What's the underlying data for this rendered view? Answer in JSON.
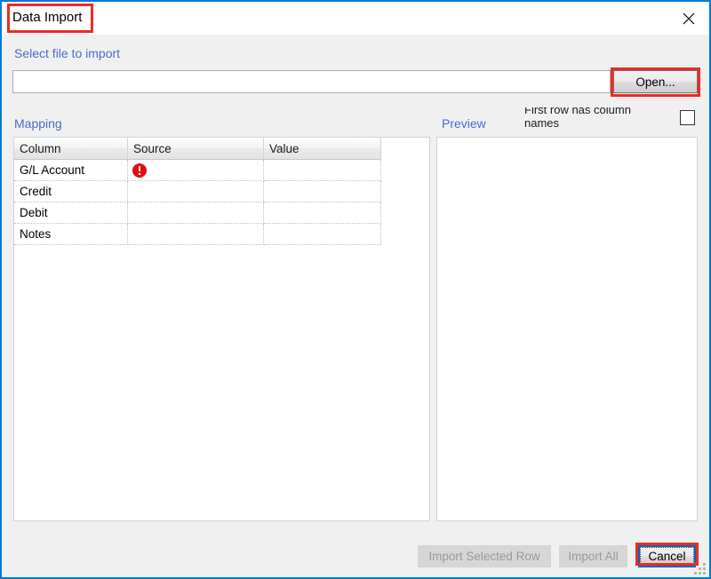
{
  "window": {
    "title": "Data Import",
    "close_icon": "close-icon",
    "accent_color": "#0078d7",
    "annotation_color": "#ee2b22"
  },
  "form": {
    "select_file_label": "Select file to import",
    "file_path_value": "",
    "file_path_placeholder": "",
    "open_button_label": "Open...",
    "first_row_label": "First row has column names",
    "first_row_checked": false
  },
  "sections": {
    "mapping_label": "Mapping",
    "preview_label": "Preview"
  },
  "grid": {
    "headers": [
      "Column",
      "Source",
      "Value"
    ],
    "rows": [
      {
        "column": "G/L Account",
        "source": "",
        "value": "",
        "selected": true,
        "status_icon": "error-icon"
      },
      {
        "column": "Credit",
        "source": "",
        "value": "",
        "selected": false,
        "status_icon": ""
      },
      {
        "column": "Debit",
        "source": "",
        "value": "",
        "selected": false,
        "status_icon": ""
      },
      {
        "column": "Notes",
        "source": "",
        "value": "",
        "selected": false,
        "status_icon": ""
      }
    ],
    "selection_color": "#2a9dee"
  },
  "preview": {
    "content": ""
  },
  "footer": {
    "import_selected_label": "Import  Selected Row",
    "import_all_label": "Import All",
    "cancel_label": "Cancel"
  }
}
